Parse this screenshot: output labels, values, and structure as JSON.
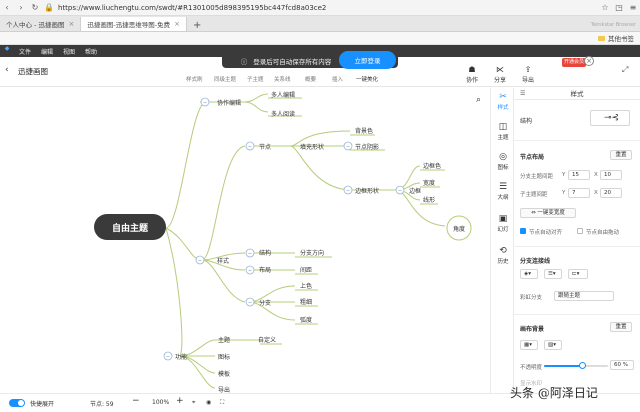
{
  "browser": {
    "url": "https://www.liuchengtu.com/swdt/#R1301005d898395195bc447fcd8a03ce2",
    "tabs": [
      {
        "label": "个人中心 - 迅捷画图",
        "active": false
      },
      {
        "label": "迅捷画图-迅捷思维导图-免费",
        "active": true
      }
    ],
    "new_tab": "+",
    "bookmark_folder": "其他书签",
    "ext_text": "Twinkstar Browser"
  },
  "menu": {
    "items": [
      "文件",
      "编辑",
      "视图",
      "帮助"
    ]
  },
  "banner": {
    "text": "登录后可自动保存所有内容",
    "button": "立即登录"
  },
  "toolbar": {
    "doc_title": "迅捷画图",
    "tools": [
      "样式刷",
      "同级主题",
      "子主题",
      "关系线",
      "概要",
      "插入",
      "一键美化"
    ],
    "right": [
      {
        "icon": "share-icon",
        "label": "协作"
      },
      {
        "icon": "share2-icon",
        "label": "分享"
      },
      {
        "icon": "export-icon",
        "label": "导出"
      }
    ],
    "vip": "开通会员"
  },
  "mindmap": {
    "root": "自由主题",
    "nodes": {
      "collab": "协作编辑",
      "multi_edit": "多人编辑",
      "multi_read": "多人阅读",
      "node": "节点",
      "fill_shape": "填充形状",
      "bg_color": "背景色",
      "node_shadow": "节点阴影",
      "border_shape": "边框形状",
      "border": "边框",
      "border_color": "边框色",
      "width": "宽度",
      "line_style": "线形",
      "corner": "角度",
      "style": "样式",
      "structure": "结构",
      "branch_dir": "分支方向",
      "layout": "布局",
      "spacing": "间距",
      "branch": "分支",
      "color": "上色",
      "thickness": "粗细",
      "arc": "弧度",
      "theme": "主题",
      "custom": "自定义",
      "function": "功能",
      "icon": "图标",
      "template": "模板",
      "export": "导出"
    }
  },
  "vbar": [
    {
      "icon": "style-icon",
      "label": "样式",
      "active": true
    },
    {
      "icon": "theme-icon",
      "label": "主题",
      "active": false
    },
    {
      "icon": "icon-icon",
      "label": "图标",
      "active": false
    },
    {
      "icon": "outline-icon",
      "label": "大纲",
      "active": false
    },
    {
      "icon": "slides-icon",
      "label": "幻灯",
      "active": false
    },
    {
      "icon": "history-icon",
      "label": "历史",
      "active": false
    }
  ],
  "panel": {
    "title": "样式",
    "structure_label": "结构",
    "node_layout": "节点布局",
    "reset1": "重置",
    "branch_spacing": "分支主题间距",
    "branch_spacing_v": [
      "Y",
      "15",
      "X",
      "10"
    ],
    "sub_spacing": "子主题间距",
    "sub_spacing_v": [
      "Y",
      "7",
      "X",
      "20"
    ],
    "equal_width": "一键变宽度",
    "node_auto_align": "节点自动对齐",
    "node_free_drag": "节点自由拖动",
    "branch_line": "分支连接线",
    "rainbow_branch": "彩虹分支",
    "rainbow_value": "跟随主题",
    "canvas_bg": "画布背景",
    "reset2": "重置",
    "opacity_label": "不透明度",
    "opacity_value": 60,
    "opacity_text": "60 %",
    "hidden_label": "显示水印"
  },
  "status": {
    "quick_label": "快捷展开",
    "node_count": "节点: 59",
    "zoom": "100%"
  },
  "watermark": "头条 @阿泽日记",
  "colors": {
    "accent": "#1890ff",
    "line": "#b5cc7a",
    "root": "#3a3a3a"
  }
}
